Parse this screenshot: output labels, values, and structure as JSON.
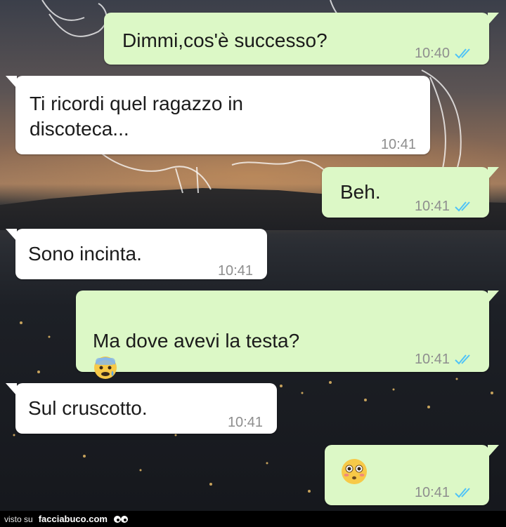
{
  "conversation": {
    "messages": [
      {
        "dir": "out",
        "text": "Dimmi,cos'è successo?",
        "time": "10:40",
        "read": true
      },
      {
        "dir": "in",
        "text": "Ti ricordi quel ragazzo in\ndiscoteca...",
        "time": "10:41"
      },
      {
        "dir": "out",
        "text": "Beh.",
        "time": "10:41",
        "read": true
      },
      {
        "dir": "in",
        "text": "Sono incinta.",
        "time": "10:41"
      },
      {
        "dir": "out",
        "text": "Ma dove avevi la testa?",
        "emoji": "fearful-face",
        "time": "10:41",
        "read": true
      },
      {
        "dir": "in",
        "text": "Sul cruscotto.",
        "time": "10:41"
      },
      {
        "dir": "out",
        "text": "",
        "emoji": "flushed-face",
        "time": "10:41",
        "read": true
      }
    ]
  },
  "colors": {
    "outgoing_bubble": "#dcf8c6",
    "incoming_bubble": "#ffffff",
    "read_ticks": "#4fc3f7",
    "timestamp": "#8e8e8e"
  },
  "footer": {
    "visto_label": "visto su",
    "site_label": "facciabuco.com"
  }
}
